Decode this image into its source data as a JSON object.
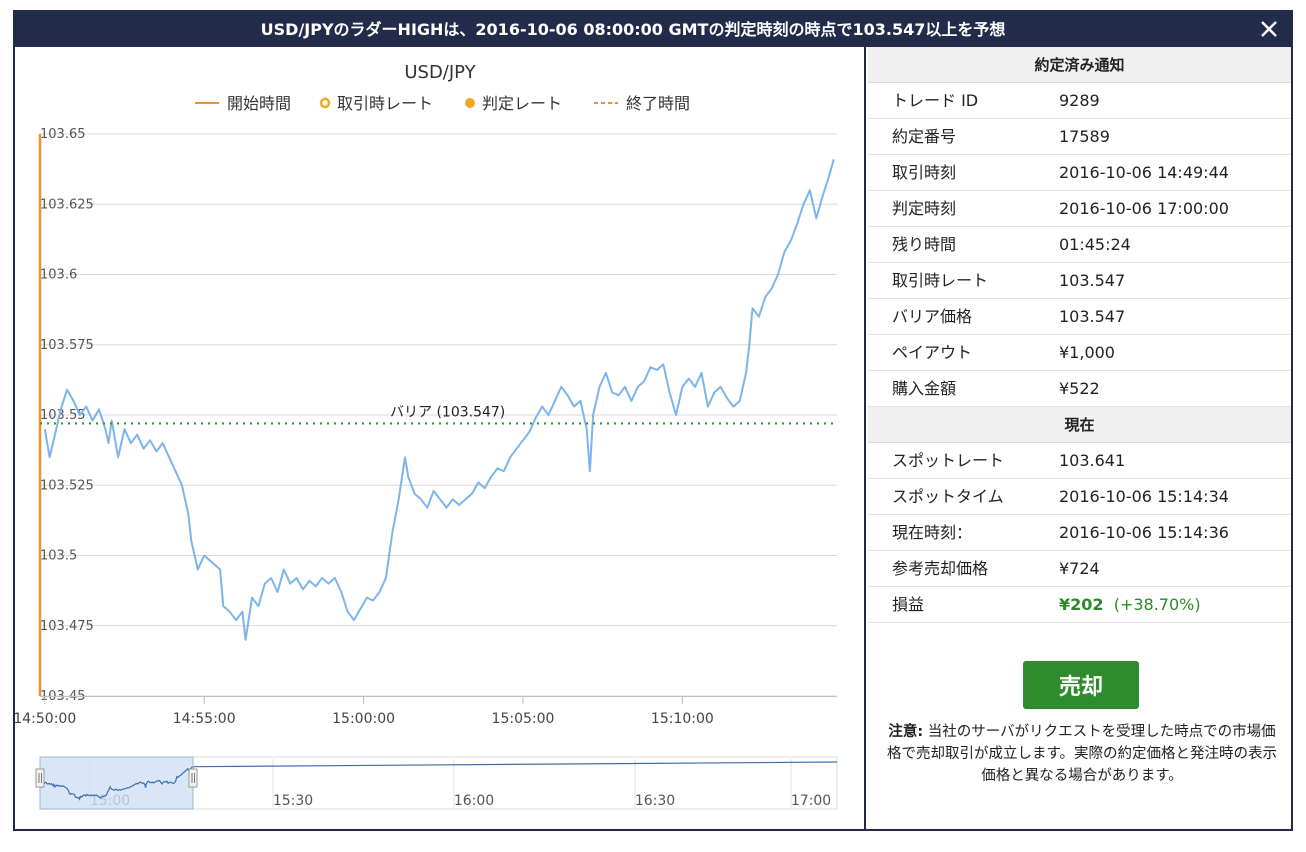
{
  "header": {
    "title": "USD/JPYのラダーHIGHは、2016-10-06 08:00:00 GMTの判定時刻の時点で103.547以上を予想",
    "close_symbol": "✕"
  },
  "chart": {
    "title": "USD/JPY",
    "legend": [
      {
        "label": "開始時間",
        "symbol": "solid-line",
        "color": "#f0922b"
      },
      {
        "label": "取引時レート",
        "symbol": "hollow-circle",
        "color": "#f5a623"
      },
      {
        "label": "判定レート",
        "symbol": "filled-circle",
        "color": "#f5a623"
      },
      {
        "label": "終了時間",
        "symbol": "dashed-line",
        "color": "#f0922b"
      }
    ],
    "barrier_label": "バリア (103.547)",
    "navigator_ticks": [
      "15:00",
      "15:30",
      "16:00",
      "16:30",
      "17:00"
    ]
  },
  "chart_data": {
    "type": "line",
    "title": "USD/JPY",
    "ylim": [
      103.45,
      103.65
    ],
    "yticks": [
      "103.65",
      "103.625",
      "103.6",
      "103.575",
      "103.55",
      "103.525",
      "103.5",
      "103.475",
      "103.45"
    ],
    "xticks": [
      "14:50:00",
      "14:55:00",
      "15:00:00",
      "15:05:00",
      "15:10:00"
    ],
    "xlim_minutes": [
      -0.15,
      24.85
    ],
    "barrier": 103.547,
    "start_marker_minute": -0.15,
    "series": [
      {
        "color": "#7cb5ec",
        "points": [
          [
            0.0,
            103.545
          ],
          [
            0.15,
            103.535
          ],
          [
            0.3,
            103.542
          ],
          [
            0.5,
            103.552
          ],
          [
            0.7,
            103.559
          ],
          [
            0.9,
            103.555
          ],
          [
            1.1,
            103.55
          ],
          [
            1.3,
            103.553
          ],
          [
            1.5,
            103.548
          ],
          [
            1.7,
            103.552
          ],
          [
            1.9,
            103.545
          ],
          [
            2.0,
            103.54
          ],
          [
            2.1,
            103.548
          ],
          [
            2.3,
            103.535
          ],
          [
            2.5,
            103.545
          ],
          [
            2.7,
            103.54
          ],
          [
            2.9,
            103.543
          ],
          [
            3.1,
            103.538
          ],
          [
            3.3,
            103.541
          ],
          [
            3.5,
            103.537
          ],
          [
            3.7,
            103.54
          ],
          [
            3.9,
            103.535
          ],
          [
            4.1,
            103.53
          ],
          [
            4.3,
            103.525
          ],
          [
            4.5,
            103.515
          ],
          [
            4.6,
            103.505
          ],
          [
            4.8,
            103.495
          ],
          [
            5.0,
            103.5
          ],
          [
            5.3,
            103.497
          ],
          [
            5.5,
            103.495
          ],
          [
            5.6,
            103.482
          ],
          [
            5.8,
            103.48
          ],
          [
            6.0,
            103.477
          ],
          [
            6.2,
            103.48
          ],
          [
            6.3,
            103.47
          ],
          [
            6.5,
            103.485
          ],
          [
            6.7,
            103.482
          ],
          [
            6.9,
            103.49
          ],
          [
            7.1,
            103.492
          ],
          [
            7.3,
            103.487
          ],
          [
            7.5,
            103.495
          ],
          [
            7.7,
            103.49
          ],
          [
            7.9,
            103.492
          ],
          [
            8.1,
            103.488
          ],
          [
            8.3,
            103.491
          ],
          [
            8.5,
            103.489
          ],
          [
            8.7,
            103.492
          ],
          [
            8.9,
            103.49
          ],
          [
            9.1,
            103.492
          ],
          [
            9.3,
            103.487
          ],
          [
            9.5,
            103.48
          ],
          [
            9.7,
            103.477
          ],
          [
            9.9,
            103.481
          ],
          [
            10.1,
            103.485
          ],
          [
            10.3,
            103.484
          ],
          [
            10.5,
            103.487
          ],
          [
            10.7,
            103.492
          ],
          [
            10.9,
            103.508
          ],
          [
            11.1,
            103.52
          ],
          [
            11.3,
            103.535
          ],
          [
            11.4,
            103.528
          ],
          [
            11.6,
            103.522
          ],
          [
            11.8,
            103.52
          ],
          [
            12.0,
            103.517
          ],
          [
            12.2,
            103.523
          ],
          [
            12.4,
            103.52
          ],
          [
            12.6,
            103.517
          ],
          [
            12.8,
            103.52
          ],
          [
            13.0,
            103.518
          ],
          [
            13.2,
            103.52
          ],
          [
            13.4,
            103.522
          ],
          [
            13.6,
            103.526
          ],
          [
            13.8,
            103.524
          ],
          [
            14.0,
            103.528
          ],
          [
            14.2,
            103.531
          ],
          [
            14.4,
            103.53
          ],
          [
            14.6,
            103.535
          ],
          [
            14.8,
            103.538
          ],
          [
            15.0,
            103.541
          ],
          [
            15.2,
            103.544
          ],
          [
            15.4,
            103.549
          ],
          [
            15.6,
            103.553
          ],
          [
            15.8,
            103.55
          ],
          [
            16.0,
            103.555
          ],
          [
            16.2,
            103.56
          ],
          [
            16.4,
            103.557
          ],
          [
            16.6,
            103.553
          ],
          [
            16.8,
            103.555
          ],
          [
            17.0,
            103.545
          ],
          [
            17.1,
            103.53
          ],
          [
            17.2,
            103.55
          ],
          [
            17.4,
            103.56
          ],
          [
            17.6,
            103.565
          ],
          [
            17.8,
            103.558
          ],
          [
            18.0,
            103.557
          ],
          [
            18.2,
            103.56
          ],
          [
            18.4,
            103.555
          ],
          [
            18.6,
            103.56
          ],
          [
            18.8,
            103.562
          ],
          [
            19.0,
            103.567
          ],
          [
            19.2,
            103.566
          ],
          [
            19.4,
            103.568
          ],
          [
            19.6,
            103.558
          ],
          [
            19.8,
            103.55
          ],
          [
            20.0,
            103.56
          ],
          [
            20.2,
            103.563
          ],
          [
            20.4,
            103.56
          ],
          [
            20.6,
            103.565
          ],
          [
            20.8,
            103.553
          ],
          [
            21.0,
            103.558
          ],
          [
            21.2,
            103.56
          ],
          [
            21.4,
            103.556
          ],
          [
            21.6,
            103.553
          ],
          [
            21.8,
            103.555
          ],
          [
            22.0,
            103.565
          ],
          [
            22.1,
            103.575
          ],
          [
            22.2,
            103.588
          ],
          [
            22.4,
            103.585
          ],
          [
            22.6,
            103.592
          ],
          [
            22.8,
            103.595
          ],
          [
            23.0,
            103.6
          ],
          [
            23.2,
            103.608
          ],
          [
            23.4,
            103.612
          ],
          [
            23.6,
            103.618
          ],
          [
            23.8,
            103.625
          ],
          [
            24.0,
            103.63
          ],
          [
            24.2,
            103.62
          ],
          [
            24.4,
            103.628
          ],
          [
            24.6,
            103.635
          ],
          [
            24.75,
            103.641
          ]
        ]
      }
    ],
    "navigator": {
      "xticks": [
        "15:00",
        "15:30",
        "16:00",
        "16:30",
        "17:00"
      ]
    }
  },
  "panel": {
    "contract_header": "約定済み通知",
    "contract_rows": [
      {
        "key": "トレード ID",
        "value": "9289"
      },
      {
        "key": "約定番号",
        "value": "17589"
      },
      {
        "key": "取引時刻",
        "value": "2016-10-06 14:49:44"
      },
      {
        "key": "判定時刻",
        "value": "2016-10-06 17:00:00"
      },
      {
        "key": "残り時間",
        "value": "01:45:24"
      },
      {
        "key": "取引時レート",
        "value": "103.547"
      },
      {
        "key": "バリア価格",
        "value": "103.547"
      },
      {
        "key": "ペイアウト",
        "value": "¥1,000"
      },
      {
        "key": "購入金額",
        "value": "¥522"
      }
    ],
    "current_header": "現在",
    "current_rows": [
      {
        "key": "スポットレート",
        "value": "103.641"
      },
      {
        "key": "スポットタイム",
        "value": "2016-10-06 15:14:34"
      },
      {
        "key": "現在時刻：",
        "value": "2016-10-06 15:14:36"
      },
      {
        "key": "参考売却価格",
        "value": "¥724"
      }
    ],
    "pnl": {
      "key": "損益",
      "amount": "¥202",
      "percent": "(+38.70%)",
      "color": "#2a8a2a"
    },
    "sell_label": "売却",
    "notice_label": "注意:",
    "notice_text": " 当社のサーバがリクエストを受理した時点での市場価格で売却取引が成立します。実際の約定価格と発注時の表示価格と異なる場合があります。"
  }
}
